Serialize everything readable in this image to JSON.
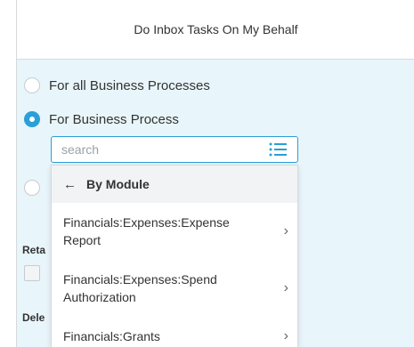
{
  "header": {
    "title": "Do Inbox Tasks On My Behalf"
  },
  "options": [
    {
      "label": "For all Business Processes",
      "checked": false
    },
    {
      "label": "For Business Process",
      "checked": true
    }
  ],
  "search": {
    "placeholder": "search"
  },
  "dropdown": {
    "back_label": "By Module",
    "items": [
      {
        "label": "Financials:Expenses:Expense Report"
      },
      {
        "label": "Financials:Expenses:Spend Authorization"
      },
      {
        "label": "Financials:Grants"
      }
    ]
  },
  "partial_labels": {
    "retain": "Reta",
    "delegate": "Dele"
  },
  "colors": {
    "accent": "#2b9fd6",
    "background": "#e8f5fa"
  }
}
